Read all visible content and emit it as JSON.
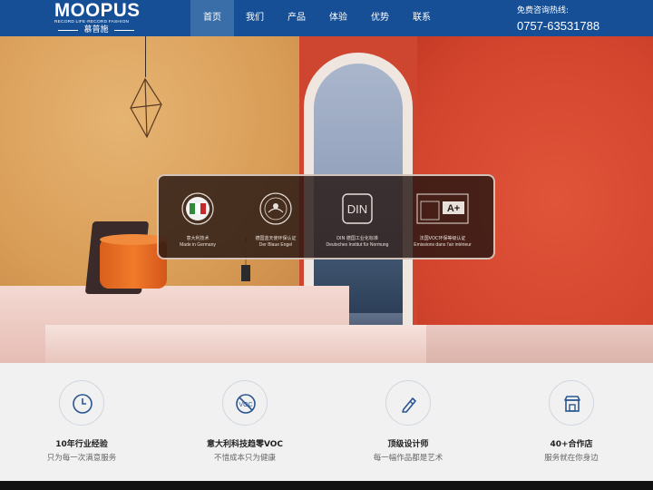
{
  "header": {
    "logo": {
      "brand": "MOOPUS",
      "tagline": "RECORD LIFE·RECORD FASHION",
      "chinese": "慕普施"
    },
    "nav": [
      "首页",
      "我们",
      "产品",
      "体验",
      "优势",
      "联系"
    ],
    "active_nav_index": 0,
    "hotline": {
      "label": "免费咨询热线:",
      "number": "0757-63531788"
    },
    "colors": {
      "header_bg": "#164f95",
      "active_nav_bg": "#3a6ea8"
    }
  },
  "banner": {
    "certificates": [
      {
        "icon": "italy-flag-seal-icon",
        "cn": "意大利技术",
        "en": "Made in Germany"
      },
      {
        "icon": "blue-angel-seal-icon",
        "cn": "德国蓝天使环保认证",
        "en": "Der Blaue Engel"
      },
      {
        "icon": "din-logo-icon",
        "logo_text": "DIN",
        "cn": "DIN 德国工业化标准",
        "en": "Deutsches Institut für Normung"
      },
      {
        "icon": "a-plus-emission-icon",
        "logo_text": "A+",
        "cn": "法国VOC环保等级认证",
        "en": "Emissions dans l'air intérieur"
      }
    ],
    "carousel": {
      "count": 4,
      "active_index": 2
    }
  },
  "features": [
    {
      "icon": "clock-icon",
      "title": "10年行业经验",
      "subtitle": "只为每一次满意服务"
    },
    {
      "icon": "no-voc-icon",
      "title": "意大利科技趋零VOC",
      "subtitle": "不惜成本只为健康"
    },
    {
      "icon": "pen-design-icon",
      "title": "顶级设计师",
      "subtitle": "每一幅作品都是艺术"
    },
    {
      "icon": "shop-icon",
      "title": "40+合作店",
      "subtitle": "服务就在你身边"
    }
  ]
}
